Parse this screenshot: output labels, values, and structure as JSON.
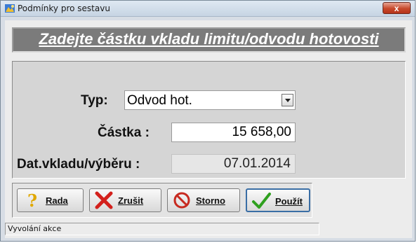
{
  "window": {
    "title": "Podmínky pro sestavu",
    "close_label": "x"
  },
  "banner": {
    "text": "Zadejte částku vkladu limitu/odvodu hotovosti"
  },
  "form": {
    "type_label": "Typ:",
    "type_value": "Odvod hot.",
    "amount_label": "Částka :",
    "amount_value": "15 658,00",
    "date_label": "Dat.vkladu/výběru :",
    "date_value": "07.01.2014"
  },
  "buttons": {
    "help_label": "Rada",
    "cancel_label": "Zrušit",
    "storno_label": "Storno",
    "apply_label": "Použít"
  },
  "status": {
    "text": "Vyvolání akce"
  }
}
